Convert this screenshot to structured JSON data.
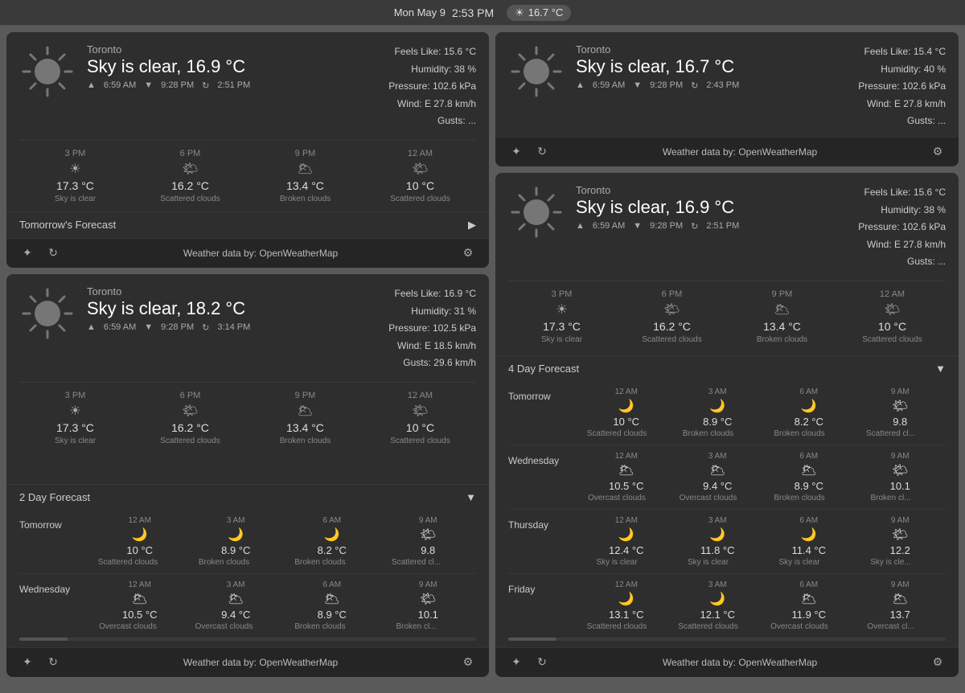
{
  "topbar": {
    "date": "Mon May 9",
    "time": "2:53 PM",
    "temp": "16.7 °C"
  },
  "widget1": {
    "city": "Toronto",
    "condition": "Sky is clear, 16.9 °C",
    "sunrise": "6:59 AM",
    "sunset": "9:28 PM",
    "updated": "2:51 PM",
    "feelsLike": "Feels Like: 15.6 °C",
    "humidity": "Humidity: 38 %",
    "pressure": "Pressure: 102.6 kPa",
    "wind": "Wind: E 27.8 km/h",
    "gusts": "Gusts: ...",
    "forecast": [
      {
        "time": "3 PM",
        "icon": "☀",
        "temp": "17.3 °C",
        "desc": "Sky is clear"
      },
      {
        "time": "6 PM",
        "icon": "🌤",
        "temp": "16.2 °C",
        "desc": "Scattered clouds"
      },
      {
        "time": "9 PM",
        "icon": "🌥",
        "temp": "13.4 °C",
        "desc": "Broken clouds"
      },
      {
        "time": "12 AM",
        "icon": "🌤",
        "temp": "10 °C",
        "desc": "Scattered clouds"
      }
    ],
    "tomorrowLabel": "Tomorrow's Forecast",
    "footerText": "Weather data by:  OpenWeatherMap"
  },
  "widget2": {
    "city": "Toronto",
    "condition": "Sky is clear, 16.7 °C",
    "sunrise": "6:59 AM",
    "sunset": "9:28 PM",
    "updated": "2:43 PM",
    "feelsLike": "Feels Like: 15.4 °C",
    "humidity": "Humidity: 40 %",
    "pressure": "Pressure: 102.6 kPa",
    "wind": "Wind: E 27.8 km/h",
    "gusts": "Gusts: ...",
    "footerText": "Weather data by:  OpenWeatherMap"
  },
  "widget3": {
    "city": "Toronto",
    "condition": "Sky is clear, 16.9 °C",
    "sunrise": "6:59 AM",
    "sunset": "9:28 PM",
    "updated": "2:51 PM",
    "feelsLike": "Feels Like: 15.6 °C",
    "humidity": "Humidity: 38 %",
    "pressure": "Pressure: 102.6 kPa",
    "wind": "Wind: E 27.8 km/h",
    "gusts": "Gusts: ...",
    "forecast": [
      {
        "time": "3 PM",
        "icon": "☀",
        "temp": "17.3 °C",
        "desc": "Sky is clear"
      },
      {
        "time": "6 PM",
        "icon": "🌤",
        "temp": "16.2 °C",
        "desc": "Scattered clouds"
      },
      {
        "time": "9 PM",
        "icon": "🌥",
        "temp": "13.4 °C",
        "desc": "Broken clouds"
      },
      {
        "time": "12 AM",
        "icon": "🌤",
        "temp": "10 °C",
        "desc": "Scattered clouds"
      }
    ],
    "forecastLabel": "4 Day Forecast",
    "days": [
      {
        "label": "Tomorrow",
        "slots": [
          {
            "time": "12 AM",
            "icon": "🌙",
            "temp": "10 °C",
            "desc": "Scattered clouds"
          },
          {
            "time": "3 AM",
            "icon": "🌙",
            "temp": "8.9 °C",
            "desc": "Broken clouds"
          },
          {
            "time": "6 AM",
            "icon": "🌙",
            "temp": "8.2 °C",
            "desc": "Broken clouds"
          },
          {
            "time": "9 AM",
            "icon": "🌤",
            "temp": "9.8",
            "desc": "Scattered cl..."
          }
        ]
      },
      {
        "label": "Wednesday",
        "slots": [
          {
            "time": "12 AM",
            "icon": "🌥",
            "temp": "10.5 °C",
            "desc": "Overcast clouds"
          },
          {
            "time": "3 AM",
            "icon": "🌥",
            "temp": "9.4 °C",
            "desc": "Overcast clouds"
          },
          {
            "time": "6 AM",
            "icon": "🌥",
            "temp": "8.9 °C",
            "desc": "Broken clouds"
          },
          {
            "time": "9 AM",
            "icon": "🌤",
            "temp": "10.1",
            "desc": "Broken cl..."
          }
        ]
      },
      {
        "label": "Thursday",
        "slots": [
          {
            "time": "12 AM",
            "icon": "🌙",
            "temp": "12.4 °C",
            "desc": "Sky is clear"
          },
          {
            "time": "3 AM",
            "icon": "🌙",
            "temp": "11.8 °C",
            "desc": "Sky is clear"
          },
          {
            "time": "6 AM",
            "icon": "🌙",
            "temp": "11.4 °C",
            "desc": "Sky is clear"
          },
          {
            "time": "9 AM",
            "icon": "🌤",
            "temp": "12.2",
            "desc": "Sky is cle..."
          }
        ]
      },
      {
        "label": "Friday",
        "slots": [
          {
            "time": "12 AM",
            "icon": "🌙",
            "temp": "13.1 °C",
            "desc": "Scattered clouds"
          },
          {
            "time": "3 AM",
            "icon": "🌙",
            "temp": "12.1 °C",
            "desc": "Scattered clouds"
          },
          {
            "time": "6 AM",
            "icon": "🌥",
            "temp": "11.9 °C",
            "desc": "Overcast clouds"
          },
          {
            "time": "9 AM",
            "icon": "🌥",
            "temp": "13.7",
            "desc": "Overcast cl..."
          }
        ]
      }
    ],
    "footerText": "Weather data by:  OpenWeatherMap"
  },
  "widget4": {
    "city": "Toronto",
    "condition": "Sky is clear, 18.2 °C",
    "sunrise": "6:59 AM",
    "sunset": "9:28 PM",
    "updated": "3:14 PM",
    "feelsLike": "Feels Like: 16.9 °C",
    "humidity": "Humidity: 31 %",
    "pressure": "Pressure: 102.5 kPa",
    "wind": "Wind: E 18.5 km/h",
    "gusts": "Gusts: 29.6 km/h",
    "forecast": [
      {
        "time": "3 PM",
        "icon": "☀",
        "temp": "17.3 °C",
        "desc": "Sky is clear"
      },
      {
        "time": "6 PM",
        "icon": "🌤",
        "temp": "16.2 °C",
        "desc": "Scattered clouds"
      },
      {
        "time": "9 PM",
        "icon": "🌥",
        "temp": "13.4 °C",
        "desc": "Broken clouds"
      },
      {
        "time": "12 AM",
        "icon": "🌤",
        "temp": "10 °C",
        "desc": "Scattered clouds"
      }
    ],
    "forecastLabel": "2 Day Forecast",
    "days": [
      {
        "label": "Tomorrow",
        "slots": [
          {
            "time": "12 AM",
            "icon": "🌙",
            "temp": "10 °C",
            "desc": "Scattered clouds"
          },
          {
            "time": "3 AM",
            "icon": "🌙",
            "temp": "8.9 °C",
            "desc": "Broken clouds"
          },
          {
            "time": "6 AM",
            "icon": "🌙",
            "temp": "8.2 °C",
            "desc": "Broken clouds"
          },
          {
            "time": "9 AM",
            "icon": "🌤",
            "temp": "9.8",
            "desc": "Scattered cl..."
          }
        ]
      },
      {
        "label": "Wednesday",
        "slots": [
          {
            "time": "12 AM",
            "icon": "🌥",
            "temp": "10.5 °C",
            "desc": "Overcast clouds"
          },
          {
            "time": "3 AM",
            "icon": "🌥",
            "temp": "9.4 °C",
            "desc": "Overcast clouds"
          },
          {
            "time": "6 AM",
            "icon": "🌥",
            "temp": "8.9 °C",
            "desc": "Broken clouds"
          },
          {
            "time": "9 AM",
            "icon": "🌤",
            "temp": "10.1",
            "desc": "Broken cl..."
          }
        ]
      }
    ],
    "footerText": "Weather data by:  OpenWeatherMap"
  },
  "labels": {
    "weatherData": "Weather data by:",
    "openWeatherMap": "OpenWeatherMap"
  }
}
